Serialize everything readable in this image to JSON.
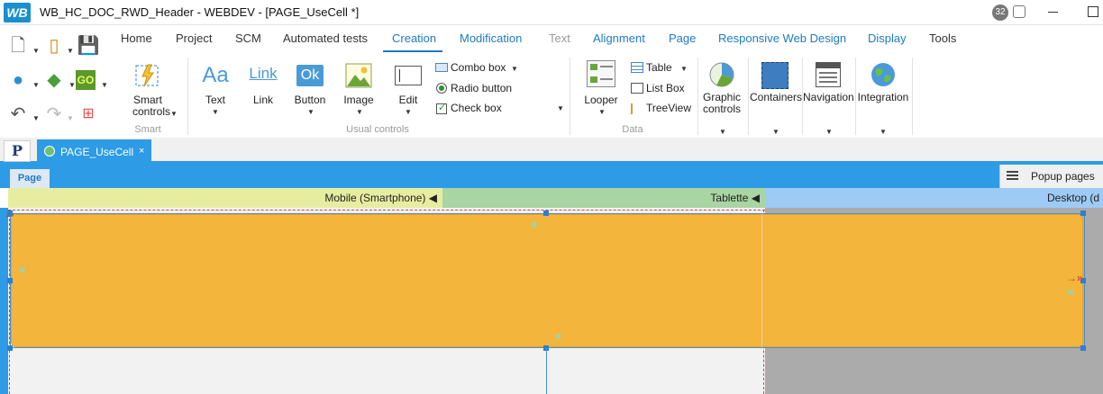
{
  "window": {
    "logo": "WB",
    "title": "WB_HC_DOC_RWD_Header - WEBDEV - [PAGE_UseCell *]",
    "badge": "32"
  },
  "menu": {
    "tabs": [
      {
        "label": "Home"
      },
      {
        "label": "Project"
      },
      {
        "label": "SCM"
      },
      {
        "label": "Automated tests"
      },
      {
        "label": "Creation"
      },
      {
        "label": "Modification"
      },
      {
        "label": "Text"
      },
      {
        "label": "Alignment"
      },
      {
        "label": "Page"
      },
      {
        "label": "Responsive Web Design"
      },
      {
        "label": "Display"
      },
      {
        "label": "Tools"
      }
    ]
  },
  "ribbon": {
    "smart": {
      "line1": "Smart",
      "line2": "controls",
      "group": "Smart"
    },
    "usual": {
      "text_icon": "Aa",
      "text": "Text",
      "link_icon": "Link",
      "link": "Link",
      "button_icon": "Ok",
      "button": "Button",
      "image": "Image",
      "edit": "Edit",
      "combo": "Combo box",
      "radio": "Radio button",
      "check": "Check box",
      "group": "Usual controls"
    },
    "data": {
      "looper": "Looper",
      "table": "Table",
      "listbox": "List Box",
      "treeview": "TreeView",
      "group": "Data"
    },
    "graphic": {
      "line1": "Graphic",
      "line2": "controls"
    },
    "containers": "Containers",
    "navigation": "Navigation",
    "integration": "Integration"
  },
  "doc_tabs": {
    "p_tab": "P",
    "page_tab": "PAGE_UseCell",
    "close": "×"
  },
  "page_editor": {
    "page_button": "Page",
    "popup_pages": "Popup pages",
    "strips": {
      "mobile": "Mobile (Smartphone) ◀",
      "tablet": "Tablette ◀",
      "desktop": "Desktop (d"
    },
    "anchor_symbol": "→»"
  },
  "colors": {
    "accent": "#2d9be5",
    "cell": "#f3b53b",
    "mobile_strip": "#e7eda0",
    "tablet_strip": "#a8d5a3",
    "desktop_strip": "#9ecbf5"
  }
}
